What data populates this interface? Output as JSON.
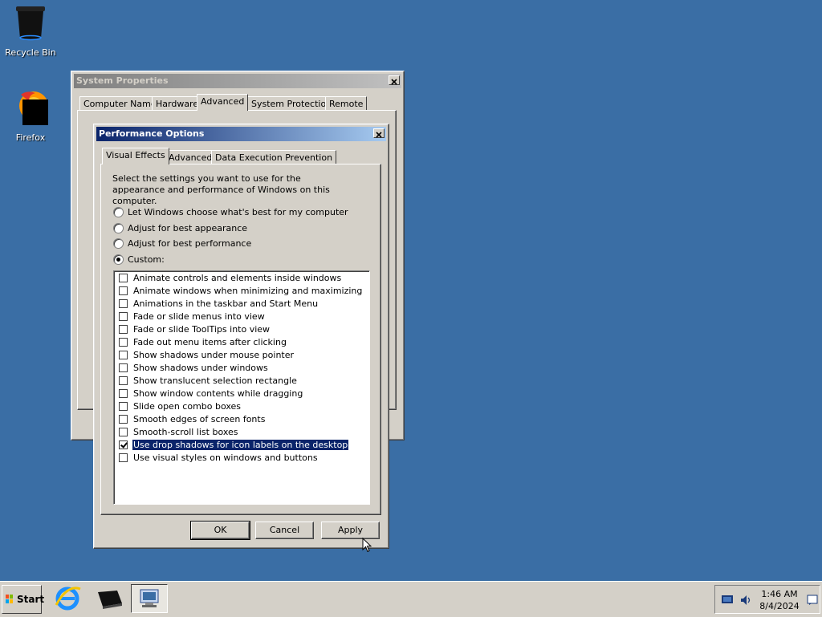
{
  "desktop": {
    "recycle_bin_label": "Recycle Bin",
    "firefox_label": "Firefox"
  },
  "system_properties": {
    "title": "System Properties",
    "tabs": [
      "Computer Name",
      "Hardware",
      "Advanced",
      "System Protection",
      "Remote"
    ],
    "selected_tab": "Advanced"
  },
  "performance_options": {
    "title": "Performance Options",
    "tabs": [
      "Visual Effects",
      "Advanced",
      "Data Execution Prevention"
    ],
    "selected_tab": "Visual Effects",
    "description": "Select the settings you want to use for the appearance and performance of Windows on this computer.",
    "radios": [
      {
        "label": "Let Windows choose what's best for my computer",
        "checked": false
      },
      {
        "label": "Adjust for best appearance",
        "checked": false
      },
      {
        "label": "Adjust for best performance",
        "checked": false
      },
      {
        "label": "Custom:",
        "checked": true
      }
    ],
    "effects": [
      {
        "label": "Animate controls and elements inside windows",
        "checked": false
      },
      {
        "label": "Animate windows when minimizing and maximizing",
        "checked": false
      },
      {
        "label": "Animations in the taskbar and Start Menu",
        "checked": false
      },
      {
        "label": "Fade or slide menus into view",
        "checked": false
      },
      {
        "label": "Fade or slide ToolTips into view",
        "checked": false
      },
      {
        "label": "Fade out menu items after clicking",
        "checked": false
      },
      {
        "label": "Show shadows under mouse pointer",
        "checked": false
      },
      {
        "label": "Show shadows under windows",
        "checked": false
      },
      {
        "label": "Show translucent selection rectangle",
        "checked": false
      },
      {
        "label": "Show window contents while dragging",
        "checked": false
      },
      {
        "label": "Slide open combo boxes",
        "checked": false
      },
      {
        "label": "Smooth edges of screen fonts",
        "checked": false
      },
      {
        "label": "Smooth-scroll list boxes",
        "checked": false
      },
      {
        "label": "Use drop shadows for icon labels on the desktop",
        "checked": true,
        "selected": true
      },
      {
        "label": "Use visual styles on windows and buttons",
        "checked": false
      }
    ],
    "buttons": {
      "ok": "OK",
      "cancel": "Cancel",
      "apply": "Apply"
    }
  },
  "taskbar": {
    "start_label": "Start",
    "clock_time": "1:46 AM",
    "clock_date": "8/4/2024"
  },
  "colors": {
    "desktop": "#3a6ea5",
    "active_title": "#0a246a",
    "face": "#d4d0c8"
  }
}
